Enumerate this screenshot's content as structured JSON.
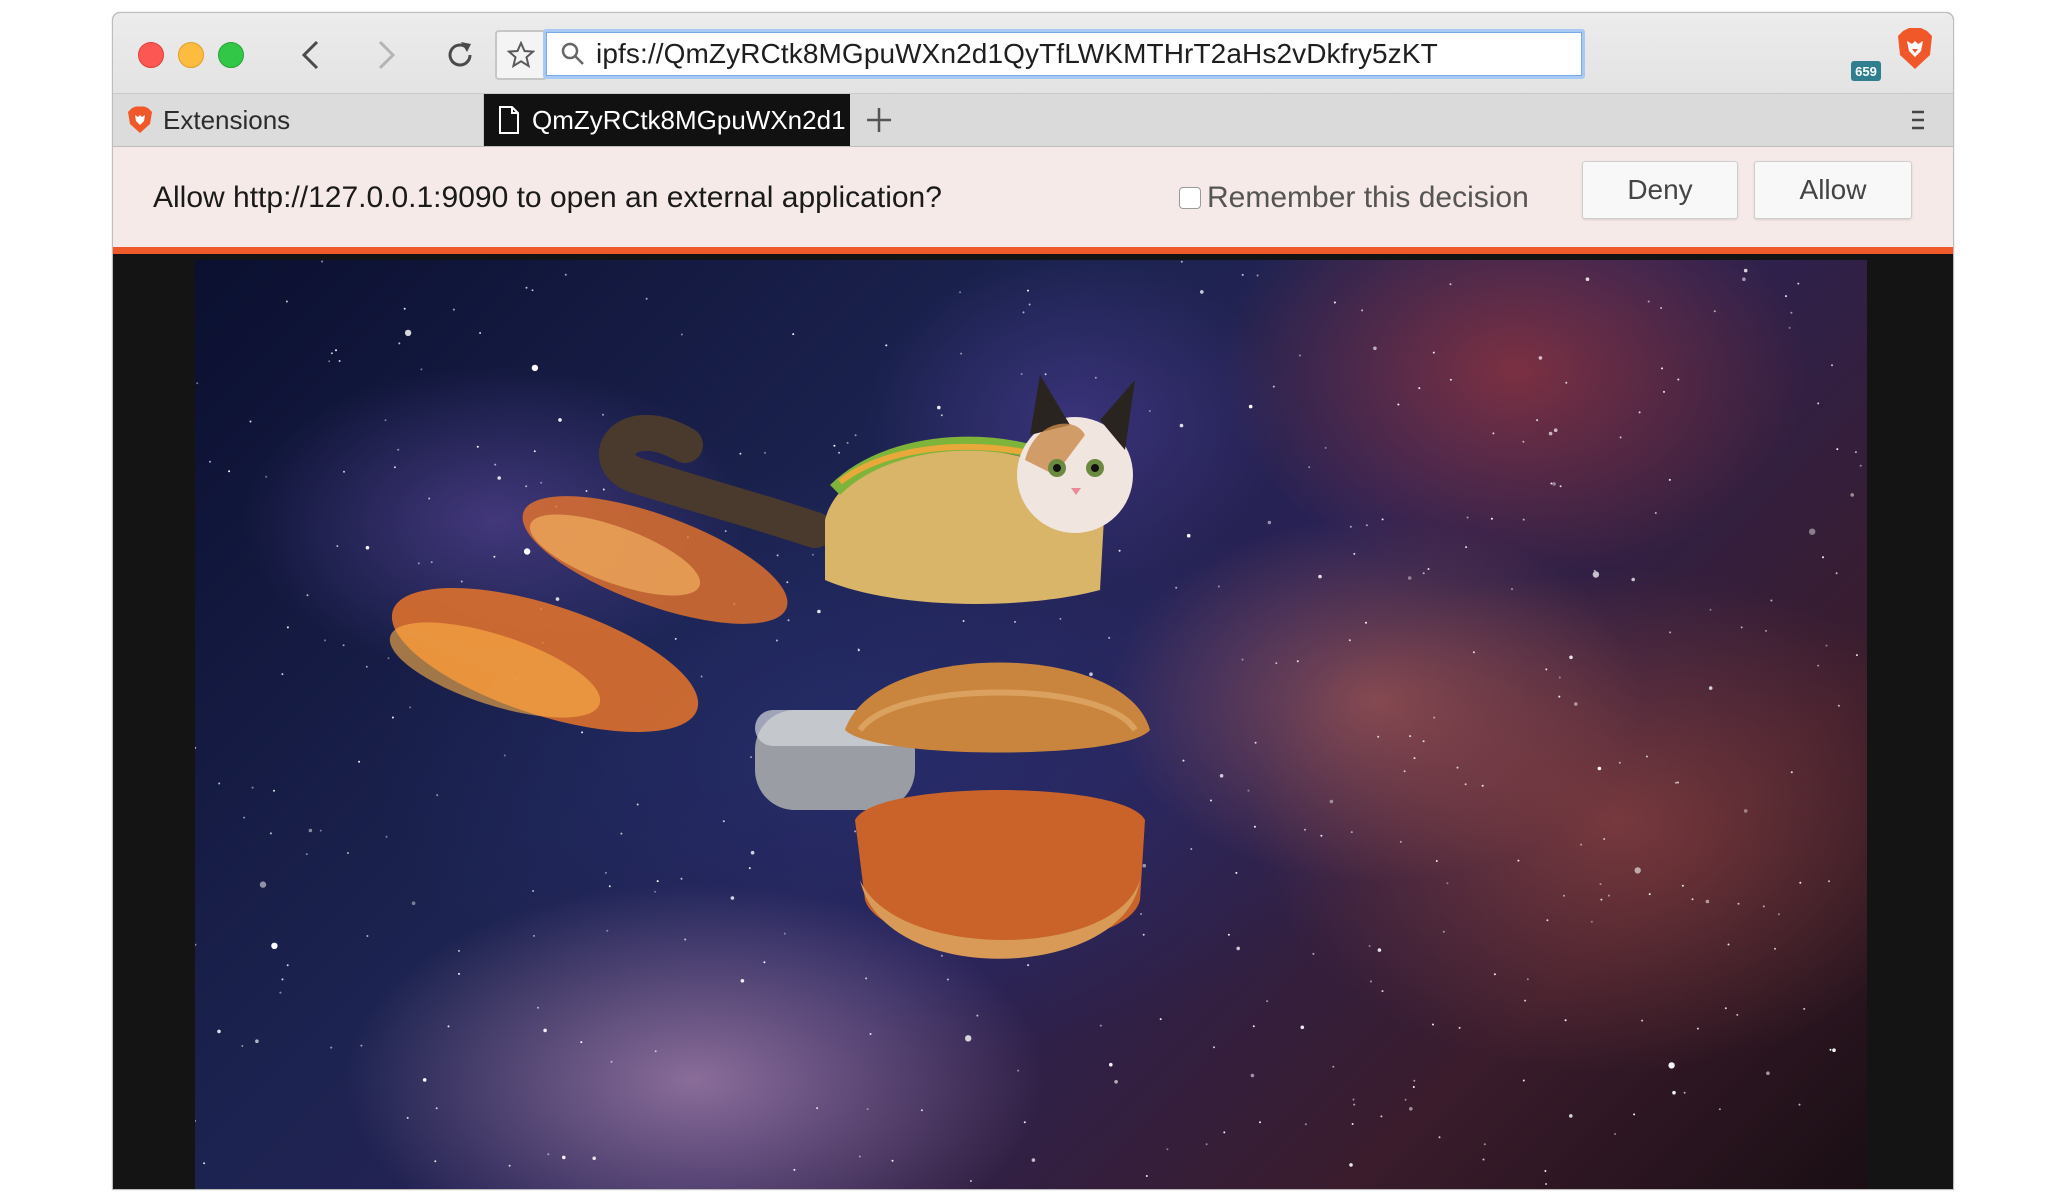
{
  "browser": {
    "url": "ipfs://QmZyRCtk8MGpuWXn2d1QyTfLWKMTHrT2aHs2vDkfry5zKT",
    "extension_badge": "659"
  },
  "tabs": [
    {
      "label": "Extensions",
      "active": false
    },
    {
      "label": "QmZyRCtk8MGpuWXn2d1",
      "active": true
    }
  ],
  "notification": {
    "message": "Allow http://127.0.0.1:9090 to open an external application?",
    "remember_label": "Remember this decision",
    "remember_checked": false,
    "deny_label": "Deny",
    "allow_label": "Allow"
  },
  "colors": {
    "notification_accent": "#ee5a2a",
    "brave_orange": "#f0582a",
    "active_tab": "#111111"
  },
  "content": {
    "image_description_icon": "space-taco-cat-image"
  }
}
